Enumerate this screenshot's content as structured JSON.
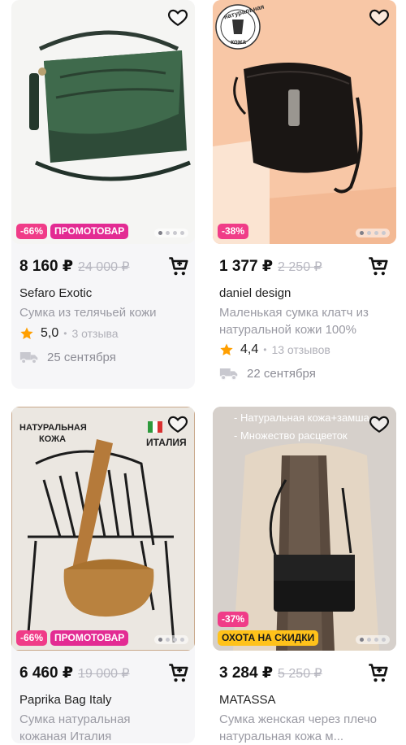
{
  "products": [
    {
      "price": "8 160 ₽",
      "old_price": "24 000 ₽",
      "brand": "Sefaro Exotic",
      "description": "Сумка из телячьей кожи",
      "rating": "5,0",
      "reviews": "3 отзыва",
      "delivery": "25 сентября",
      "badges": {
        "discount": "-66%",
        "promo": "ПРОМОТОВАР"
      }
    },
    {
      "price": "1 377 ₽",
      "old_price": "2 250 ₽",
      "brand": "daniel design",
      "description": "Маленькая сумка клатч из натуральной кожи 100%",
      "rating": "4,4",
      "reviews": "13 отзывов",
      "delivery": "22 сентября",
      "badges": {
        "discount": "-38%"
      },
      "image_text": {
        "seal_top": "натуральная",
        "seal_bottom": "кожа"
      }
    },
    {
      "price": "6 460 ₽",
      "old_price": "19 000 ₽",
      "brand": "Paprika Bag Italy",
      "description": "Сумка натуральная кожаная Италия",
      "badges": {
        "discount": "-66%",
        "promo": "ПРОМОТОВАР"
      },
      "image_text": {
        "left_1": "НАТУРАЛЬНАЯ",
        "left_2": "КОЖА",
        "right": "ИТАЛИЯ"
      }
    },
    {
      "price": "3 284 ₽",
      "old_price": "5 250 ₽",
      "brand": "MATASSA",
      "description": "Сумка женская через плечо натуральная кожа м...",
      "badges": {
        "discount": "-37%",
        "hunt": "ОХОТА НА СКИДКИ"
      },
      "image_text": {
        "line_1": "- Натуральная кожа+замша",
        "line_2": "- Множество расцветок"
      }
    }
  ],
  "colors": {
    "accent": "#f03c88",
    "promo": "#e32b93",
    "hunt": "#ffc21a",
    "star": "#ff9f00"
  }
}
